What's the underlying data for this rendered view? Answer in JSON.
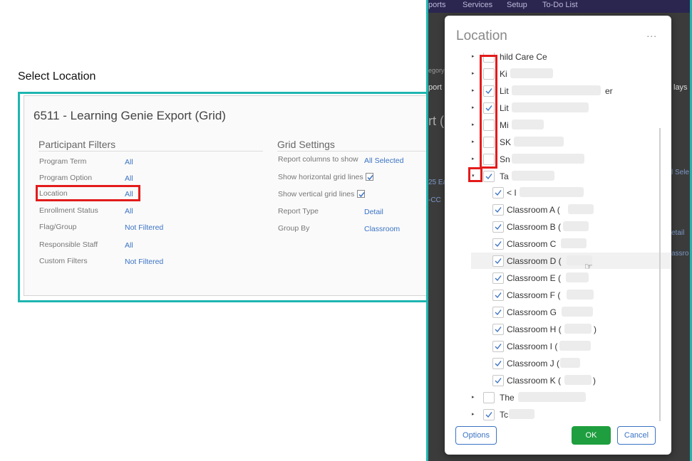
{
  "caption": "Select Location",
  "left_panel": {
    "title": "6511 - Learning Genie Export (Grid)",
    "participant_filters": {
      "heading": "Participant Filters",
      "rows": [
        {
          "label": "Program Term",
          "value": "All"
        },
        {
          "label": "Program Option",
          "value": "All"
        },
        {
          "label": "Location",
          "value": "All"
        },
        {
          "label": "Enrollment Status",
          "value": "All"
        },
        {
          "label": "Flag/Group",
          "value": "Not Filtered"
        },
        {
          "label": "Responsible Staff",
          "value": "All"
        },
        {
          "label": "Custom Filters",
          "value": "Not Filtered"
        }
      ]
    },
    "grid_settings": {
      "heading": "Grid Settings",
      "report_columns": {
        "label": "Report columns to show",
        "value": "All Selected"
      },
      "horizontal_lines": {
        "label": "Show horizontal grid lines",
        "checked": true
      },
      "vertical_lines": {
        "label": "Show vertical grid lines",
        "checked": true
      },
      "report_type": {
        "label": "Report Type",
        "value": "Detail"
      },
      "group_by": {
        "label": "Group By",
        "value": "Classroom"
      }
    }
  },
  "background_app": {
    "nav": [
      "ports",
      "Services",
      "Setup",
      "To-Do List"
    ],
    "fragments": [
      "egory",
      "port",
      "lays",
      "rt (",
      "25 Ea",
      "-CC",
      "l Sele",
      "etail",
      "assro"
    ]
  },
  "modal": {
    "title": "Location",
    "more_menu": "...",
    "partial_top_label": "hild Care Ce",
    "top_items": [
      {
        "label": "Ki",
        "checked": false
      },
      {
        "label": "Lit",
        "suffix": "er",
        "checked": true
      },
      {
        "label": "Lit",
        "checked": true
      },
      {
        "label": "Mi",
        "checked": false
      },
      {
        "label": "SK",
        "checked": false
      },
      {
        "label": "Sn",
        "checked": false
      }
    ],
    "expanded_item": {
      "label": "Ta",
      "checked": true
    },
    "children": [
      {
        "label": "< I",
        "checked": true
      },
      {
        "label": "Classroom A (",
        "checked": true
      },
      {
        "label": "Classroom B (",
        "checked": true
      },
      {
        "label": "Classroom C",
        "checked": true
      },
      {
        "label": "Classroom D (",
        "checked": true
      },
      {
        "label": "Classroom E (",
        "checked": true
      },
      {
        "label": "Classroom F (",
        "checked": true
      },
      {
        "label": "Classroom G",
        "checked": true
      },
      {
        "label": "Classroom H (",
        "suffix": ")",
        "checked": true
      },
      {
        "label": "Classroom I (",
        "checked": true
      },
      {
        "label": "Classroom J (",
        "checked": true
      },
      {
        "label": "Classroom K (",
        "suffix": ")",
        "checked": true
      }
    ],
    "bottom_items": [
      {
        "label": "The",
        "checked": false
      },
      {
        "label": "Tc",
        "checked": true
      }
    ],
    "buttons": {
      "options": "Options",
      "ok": "OK",
      "cancel": "Cancel"
    }
  },
  "colors": {
    "teal_border": "#1fb5b0",
    "highlight_red": "#e31b1b",
    "link_blue": "#3a73c4",
    "ok_green": "#1e9e3e",
    "check_blue": "#3a73c4"
  }
}
